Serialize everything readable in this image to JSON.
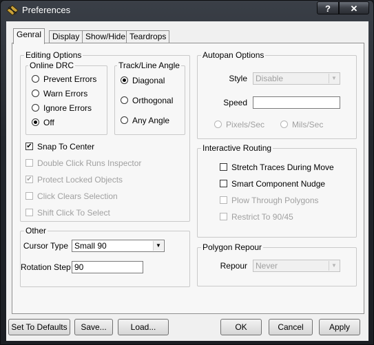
{
  "window": {
    "title": "Preferences",
    "help_label": "?",
    "close_label": "✕"
  },
  "tabs": [
    {
      "label": "Genral",
      "active": true
    },
    {
      "label": "Display"
    },
    {
      "label": "Show/Hide"
    },
    {
      "label": "Teardrops"
    }
  ],
  "editing": {
    "legend": "Editing Options",
    "online_drc": {
      "legend": "Online DRC",
      "options": [
        "Prevent Errors",
        "Warn Errors",
        "Ignore Errors",
        "Off"
      ],
      "selected": "Off"
    },
    "track_angle": {
      "legend": "Track/Line Angle",
      "options": [
        "Diagonal",
        "Orthogonal",
        "Any Angle"
      ],
      "selected": "Diagonal"
    },
    "checks": [
      {
        "label": "Snap To Center",
        "checked": true,
        "enabled": true
      },
      {
        "label": "Double Click Runs Inspector",
        "checked": false,
        "enabled": false
      },
      {
        "label": "Protect Locked Objects",
        "checked": true,
        "enabled": false
      },
      {
        "label": "Click Clears Selection",
        "checked": false,
        "enabled": false
      },
      {
        "label": "Shift Click To Select",
        "checked": false,
        "enabled": false
      }
    ]
  },
  "other": {
    "legend": "Other",
    "cursor_type_label": "Cursor Type",
    "cursor_type_value": "Small 90",
    "rotation_step_label": "Rotation Step",
    "rotation_step_value": "90"
  },
  "autopan": {
    "legend": "Autopan Options",
    "style_label": "Style",
    "style_value": "Disable",
    "speed_label": "Speed",
    "speed_value": "",
    "units": [
      "Pixels/Sec",
      "Mils/Sec"
    ]
  },
  "routing": {
    "legend": "Interactive Routing",
    "checks": [
      {
        "label": "Stretch Traces During Move",
        "checked": false,
        "enabled": true
      },
      {
        "label": "Smart Component Nudge",
        "checked": false,
        "enabled": true
      },
      {
        "label": "Plow Through Polygons",
        "checked": false,
        "enabled": false
      },
      {
        "label": "Restrict To 90/45",
        "checked": false,
        "enabled": false
      }
    ]
  },
  "polygon": {
    "legend": "Polygon Repour",
    "repour_label": "Repour",
    "repour_value": "Never"
  },
  "buttons": {
    "defaults": "Set To Defaults",
    "save": "Save...",
    "load": "Load...",
    "ok": "OK",
    "cancel": "Cancel",
    "apply": "Apply"
  },
  "icons": {
    "app": "pcb-app-icon",
    "dropdown": "chevron-down-icon"
  }
}
